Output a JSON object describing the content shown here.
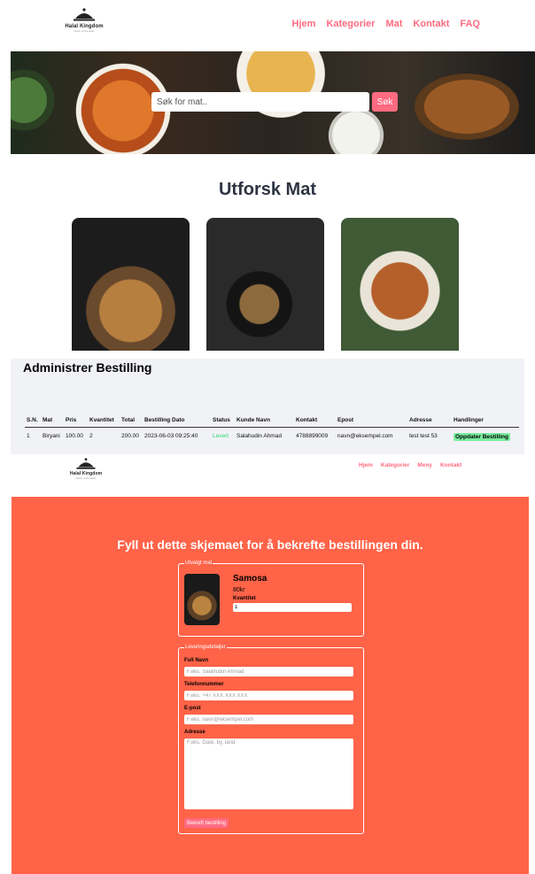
{
  "header": {
    "logo_name": "Halal Kingdom",
    "logo_sub": "Spice of the East",
    "nav": [
      "Hjem",
      "Kategorier",
      "Mat",
      "Kontakt",
      "FAQ"
    ]
  },
  "hero": {
    "search_placeholder": "Søk for mat..",
    "search_button": "Søk"
  },
  "explore": {
    "title": "Utforsk Mat"
  },
  "admin": {
    "title": "Administrer Bestilling",
    "columns": [
      "S.N.",
      "Mat",
      "Pris",
      "Kvantitet",
      "Total",
      "Bestilling Dato",
      "Status",
      "Kunde Navn",
      "Kontakt",
      "Epost",
      "Adresse",
      "Handlinger"
    ],
    "rows": [
      {
        "sn": "1",
        "food": "Biryani",
        "price": "100.00",
        "qty": "2",
        "total": "200.00",
        "date": "2023-06-03 09:25:40",
        "status": "Levert",
        "customer": "Salahudin Ahmad",
        "contact": "4788899009",
        "email": "navn@eksempel.com",
        "address": "test test 53",
        "action": "Oppdater Bestilling"
      }
    ]
  },
  "nav2": {
    "items": [
      "Hjem",
      "Kategorier",
      "Meny",
      "Kontakt"
    ]
  },
  "order": {
    "title": "Fyll ut dette skjemaet for å bekrefte bestillingen din.",
    "selected_legend": "Utvalgt mat",
    "food_name": "Samosa",
    "food_price": "80kr",
    "qty_label": "Kvantitet",
    "qty_value": "1",
    "delivery_legend": "Leveringsdetaljer",
    "fullname_label": "Full Navn",
    "fullname_placeholder": "F.eks. Salahudin Ahmad",
    "phone_label": "Telefonnummer",
    "phone_placeholder": "F.eks. +47 XXX XXX XXX",
    "email_label": "E-post",
    "email_placeholder": "F.eks. navn@eksempel.com",
    "address_label": "Adresse",
    "address_placeholder": "F.eks. Gate, by, land",
    "submit_label": "Bekreft bestilling"
  },
  "colors": {
    "accent": "#ff6b81",
    "order_bg": "#ff6348",
    "admin_bg": "#f1f2f6",
    "status_delivered": "#2ed573",
    "update_button": "#7bed9f"
  }
}
